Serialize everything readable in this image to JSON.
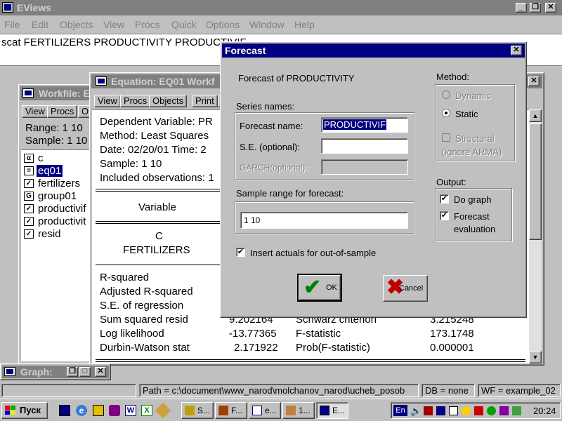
{
  "app": {
    "title": "EViews",
    "menu": [
      "File",
      "Edit",
      "Objects",
      "View",
      "Procs",
      "Quick",
      "Options",
      "Window",
      "Help"
    ],
    "command": "scat FERTILIZERS PRODUCTIVITY PRODUCTIVIF"
  },
  "workfile": {
    "title": "Workfile: E",
    "toolbar": [
      "View",
      "Procs",
      "Ol"
    ],
    "range": "Range:   1 10",
    "sample": "Sample: 1 10",
    "items": [
      {
        "badge": "α",
        "name": "c"
      },
      {
        "badge": "=",
        "name": "eq01"
      },
      {
        "badge": "✓",
        "name": "fertilizers"
      },
      {
        "badge": "G",
        "name": "group01"
      },
      {
        "badge": "✓",
        "name": "productivif"
      },
      {
        "badge": "✓",
        "name": "productivit"
      },
      {
        "badge": "✓",
        "name": "resid"
      }
    ]
  },
  "equation": {
    "title": "Equation: EQ01  Workf",
    "toolbar": [
      "View",
      "Procs",
      "Objects",
      "Print",
      "N"
    ],
    "header": [
      "Dependent Variable: PR",
      "Method: Least Squares",
      "Date: 02/20/01   Time: 2",
      "Sample: 1 10",
      "Included observations: 1"
    ],
    "variable_header": "Variable",
    "variables": [
      "C",
      "FERTILIZERS"
    ],
    "stats": [
      {
        "label": "R-squared",
        "value": "",
        "label2": "",
        "value2": ""
      },
      {
        "label": "Adjusted R-squared",
        "value": "",
        "label2": "",
        "value2": ""
      },
      {
        "label": "S.E. of regression",
        "value": "",
        "label2": "",
        "value2": ""
      },
      {
        "label": "Sum squared resid",
        "value": "9.202164",
        "label2": "Schwarz criterion",
        "value2": "3.215248"
      },
      {
        "label": "Log likelihood",
        "value": "-13.77365",
        "label2": "F-statistic",
        "value2": "173.1748"
      },
      {
        "label": "Durbin-Watson stat",
        "value": "2.171922",
        "label2": "Prob(F-statistic)",
        "value2": "0.000001"
      }
    ]
  },
  "graph_minimized": {
    "title": "Graph:"
  },
  "forecast": {
    "title": "Forecast",
    "subtitle": "Forecast of PRODUCTIVITY",
    "series_names_label": "Series names:",
    "forecast_name_label": "Forecast name:",
    "forecast_name_value": "PRODUCTIVIF",
    "se_label": "S.E. (optional):",
    "se_value": "",
    "garch_label": "GARCH(optional):",
    "sample_label": "Sample range for forecast:",
    "sample_value": "1 10",
    "insert_actuals_label": "Insert actuals for out-of-sample",
    "method_label": "Method:",
    "dynamic_label": "Dynamic",
    "static_label": "Static",
    "structural_label": "Structural",
    "ignore_arma_label": "(ignore ARMA)",
    "output_label": "Output:",
    "do_graph_label": "Do graph",
    "forecast_eval_label1": "Forecast",
    "forecast_eval_label2": "evaluation",
    "ok_label": "OK",
    "cancel_label": "Cancel"
  },
  "statusbar": {
    "path": "Path = c:\\document\\www_narod\\molchanov_narod\\ucheb_posob",
    "db": "DB = none",
    "wf": "WF = example_02"
  },
  "taskbar": {
    "start_label": "Пуск",
    "tasks": [
      "S...",
      "F...",
      "e...",
      "1...",
      "E..."
    ],
    "lang": "En",
    "clock": "20:24"
  },
  "colors": {
    "title_active": "#000080",
    "desktop": "#c0c0c0",
    "ok_check": "#008000",
    "cancel_x": "#c00000"
  }
}
